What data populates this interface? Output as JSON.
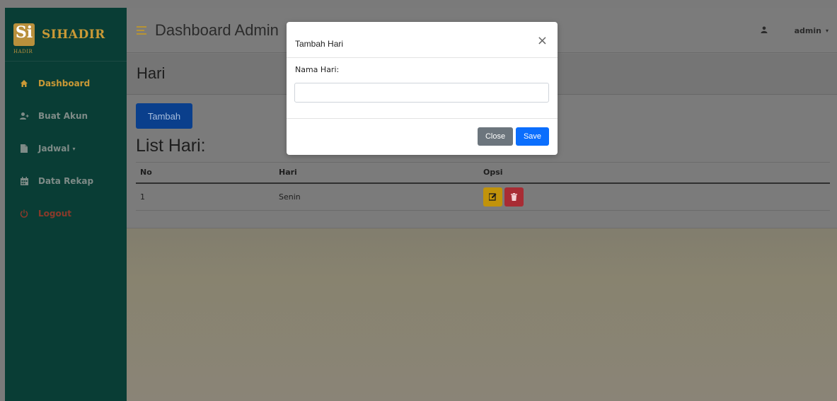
{
  "brand": {
    "logo_text": "Si",
    "logo_sub": "HADIR",
    "name": "SIHADIR",
    "accent_color": "#c99936",
    "sidebar_color": "#093d35"
  },
  "sidebar": {
    "items": [
      {
        "label": "Dashboard",
        "icon": "home-icon",
        "active": true
      },
      {
        "label": "Buat Akun",
        "icon": "user-plus-icon"
      },
      {
        "label": "Jadwal",
        "icon": "file-icon",
        "has_dropdown": true
      },
      {
        "label": "Data Rekap",
        "icon": "calendar-icon"
      },
      {
        "label": "Logout",
        "icon": "power-icon"
      }
    ]
  },
  "header": {
    "title": "Dashboard Admin",
    "user": "admin"
  },
  "page": {
    "title": "Hari",
    "add_button": "Tambah",
    "list_title": "List Hari:"
  },
  "table": {
    "headers": [
      "No",
      "Hari",
      "Opsi"
    ],
    "rows": [
      {
        "no": "1",
        "hari": "Senin"
      }
    ]
  },
  "modal": {
    "title": "Tambah Hari",
    "close_symbol": "×",
    "field_label": "Nama Hari:",
    "field_value": "",
    "close_button": "Close",
    "save_button": "Save"
  }
}
